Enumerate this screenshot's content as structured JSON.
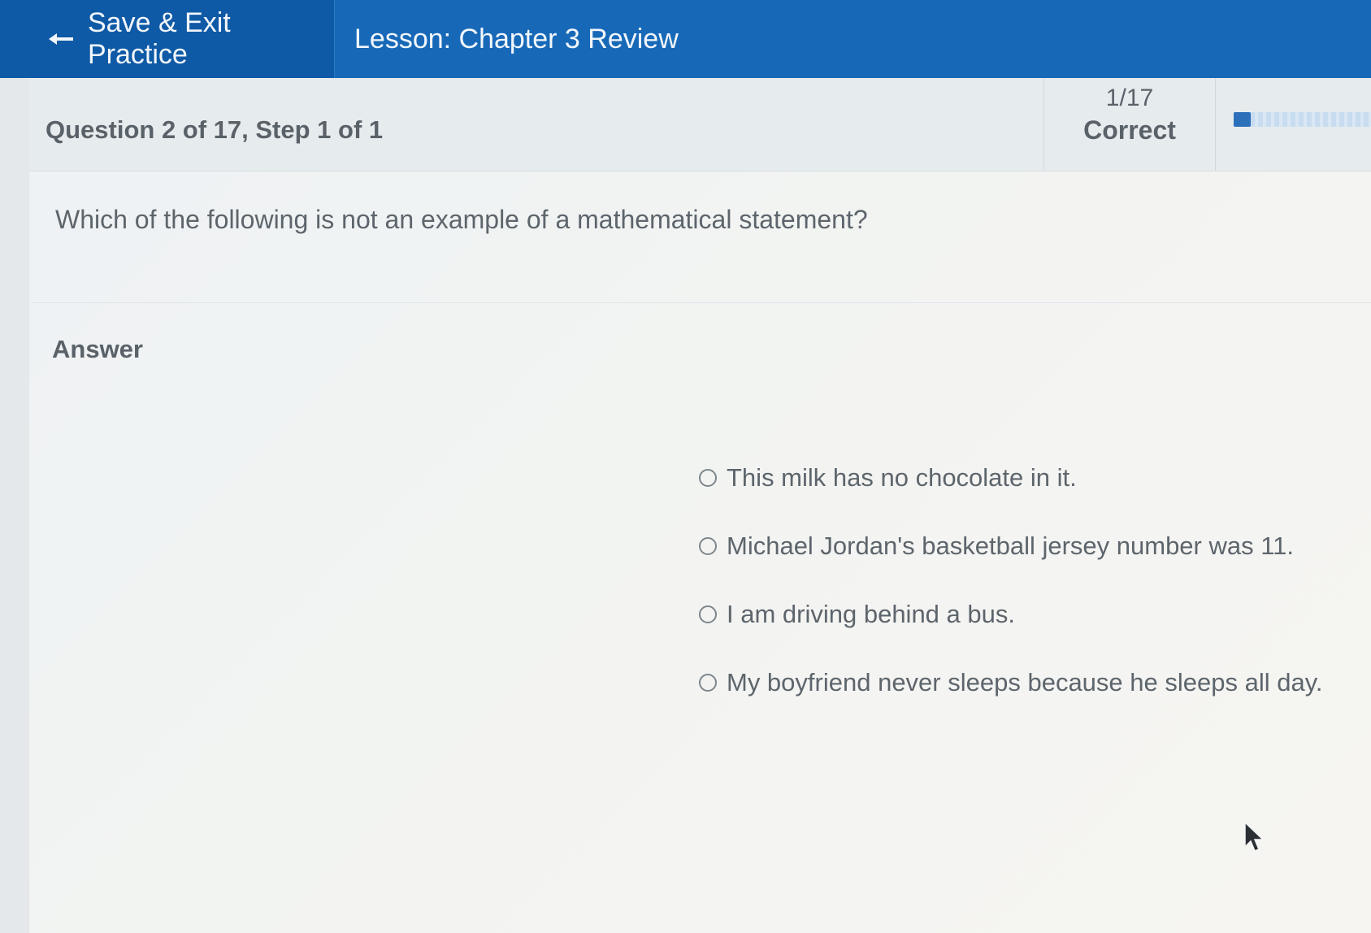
{
  "topbar": {
    "save_exit_label": "Save & Exit Practice",
    "lesson_title": "Lesson: Chapter 3 Review",
    "back_icon": "arrow-left-icon"
  },
  "question": {
    "meta": "Question 2 of 17, Step 1 of 1",
    "text": "Which of the following is not an example of a mathematical statement?"
  },
  "score": {
    "fraction": "1/17",
    "label": "Correct",
    "progress_fraction": 0.06
  },
  "answer": {
    "label": "Answer",
    "options": [
      {
        "text": "This milk has no chocolate in it."
      },
      {
        "text": "Michael Jordan's basketball jersey number was 11."
      },
      {
        "text": "I am driving behind a bus."
      },
      {
        "text": "My boyfriend never sleeps because he sleeps all day."
      }
    ]
  },
  "colors": {
    "topbar": "#1769b8",
    "save_exit_bg": "#0f5aa6",
    "progress_fill": "#2c6fba",
    "text_gray": "#5d656c"
  }
}
